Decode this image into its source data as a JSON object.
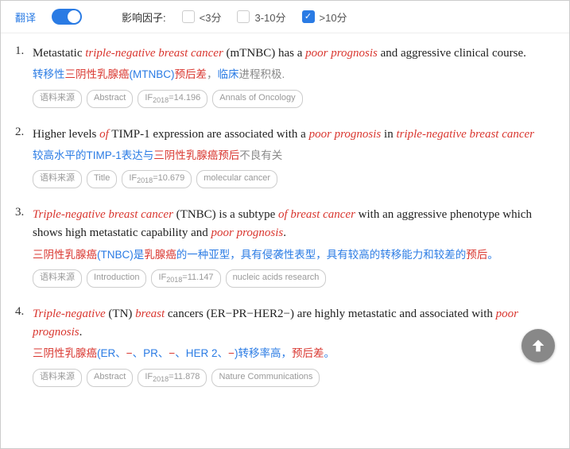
{
  "filter": {
    "translate_label": "翻译",
    "factor_label": "影响因子:",
    "options": [
      {
        "label": "<3分",
        "checked": false
      },
      {
        "label": "3-10分",
        "checked": false
      },
      {
        "label": ">10分",
        "checked": true
      }
    ]
  },
  "tag_labels": {
    "source": "语料来源"
  },
  "results": [
    {
      "num": "1.",
      "english": [
        {
          "t": "Metastatic "
        },
        {
          "t": "triple",
          "hi": true
        },
        {
          "t": "-",
          "hi": true
        },
        {
          "t": "negative breast cancer",
          "hi": true
        },
        {
          "t": " (mTNBC) has a "
        },
        {
          "t": "poor prognosis",
          "hi": true
        },
        {
          "t": " and aggressive clinical course."
        }
      ],
      "chinese": [
        {
          "t": "转移性",
          "c": "t-blue"
        },
        {
          "t": "三阴性乳腺癌",
          "c": "t-red"
        },
        {
          "t": "(",
          "c": "t-blue"
        },
        {
          "t": "MTNBC)",
          "c": "t-blue"
        },
        {
          "t": "预后差",
          "c": "t-red"
        },
        {
          "t": "，",
          "c": "t-gray"
        },
        {
          "t": "临床",
          "c": "t-blue"
        },
        {
          "t": "进程积极.",
          "c": "t-gray"
        }
      ],
      "section": "Abstract",
      "if_year": "2018",
      "if_value": "14.196",
      "journal": "Annals of Oncology"
    },
    {
      "num": "2.",
      "english": [
        {
          "t": "Higher levels "
        },
        {
          "t": "of",
          "hi": true
        },
        {
          "t": " TIMP-1 expression are associated with a "
        },
        {
          "t": "poor prognosis",
          "hi": true
        },
        {
          "t": " in "
        },
        {
          "t": "triple",
          "hi": true
        },
        {
          "t": "-",
          "hi": true
        },
        {
          "t": "negative breast cancer",
          "hi": true
        }
      ],
      "chinese": [
        {
          "t": "较高水平的TIMP-1表达与",
          "c": "t-blue"
        },
        {
          "t": "三阴性乳腺癌预后",
          "c": "t-red"
        },
        {
          "t": "不良有关",
          "c": "t-gray"
        }
      ],
      "section": "Title",
      "if_year": "2018",
      "if_value": "10.679",
      "journal": "molecular cancer"
    },
    {
      "num": "3.",
      "english": [
        {
          "t": "Triple",
          "hi": true
        },
        {
          "t": "-",
          "hi": true
        },
        {
          "t": "negative breast cancer",
          "hi": true
        },
        {
          "t": " (TNBC) is a subtype "
        },
        {
          "t": "of breast cancer",
          "hi": true
        },
        {
          "t": " with an aggressive phenotype which shows high metastatic capability and "
        },
        {
          "t": "poor prognosis",
          "hi": true
        },
        {
          "t": "."
        }
      ],
      "chinese": [
        {
          "t": "三阴性乳腺癌",
          "c": "t-red"
        },
        {
          "t": "(TNBC)是",
          "c": "t-blue"
        },
        {
          "t": "乳腺癌",
          "c": "t-red"
        },
        {
          "t": "的一种亚型，具有侵袭性表型，具有较高的转移能力和较差的",
          "c": "t-blue"
        },
        {
          "t": "预后",
          "c": "t-red"
        },
        {
          "t": "。",
          "c": "t-blue"
        }
      ],
      "section": "Introduction",
      "if_year": "2018",
      "if_value": "11.147",
      "journal": "nucleic acids research"
    },
    {
      "num": "4.",
      "english": [
        {
          "t": "Triple",
          "hi": true
        },
        {
          "t": "-",
          "hi": true
        },
        {
          "t": "negative",
          "hi": true
        },
        {
          "t": " (TN) "
        },
        {
          "t": "breast",
          "hi": true
        },
        {
          "t": " cancers (ER−PR−HER2−) are highly metastatic and associated with "
        },
        {
          "t": "poor prognosis",
          "hi": true
        },
        {
          "t": "."
        }
      ],
      "chinese": [
        {
          "t": "三阴性乳腺癌",
          "c": "t-red"
        },
        {
          "t": "(ER、",
          "c": "t-blue"
        },
        {
          "t": "−",
          "c": "t-red"
        },
        {
          "t": "、PR、",
          "c": "t-blue"
        },
        {
          "t": "−",
          "c": "t-red"
        },
        {
          "t": "、HER 2、",
          "c": "t-blue"
        },
        {
          "t": "−",
          "c": "t-red"
        },
        {
          "t": ")转移率高，",
          "c": "t-blue"
        },
        {
          "t": "预后差",
          "c": "t-red"
        },
        {
          "t": "。",
          "c": "t-blue"
        }
      ],
      "section": "Abstract",
      "if_year": "2018",
      "if_value": "11.878",
      "journal": "Nature Communications"
    }
  ]
}
